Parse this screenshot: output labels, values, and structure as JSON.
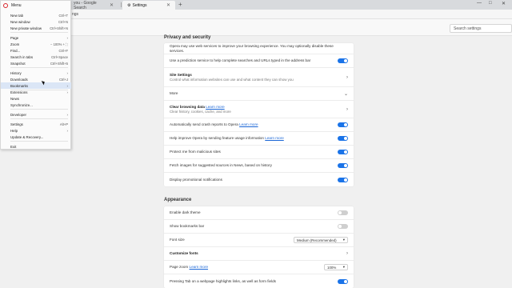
{
  "tabs": [
    {
      "label": "you - Google Search"
    },
    {
      "label": "Settings",
      "active": true
    }
  ],
  "window_controls": {
    "minimize": "—",
    "maximize": "□",
    "close": "✕"
  },
  "address": {
    "text": "ngs"
  },
  "settings": {
    "search_placeholder": "Search settings"
  },
  "menu": {
    "title": "Menu",
    "items": [
      {
        "label": "New tab",
        "shortcut": "Ctrl+T"
      },
      {
        "label": "New window",
        "shortcut": "Ctrl+N"
      },
      {
        "label": "New private window",
        "shortcut": "Ctrl+Shift+N"
      },
      {
        "label": "Page",
        "arrow": "›"
      },
      {
        "label": "Zoom",
        "shortcut": "− 100% +  ⛶"
      },
      {
        "label": "Find...",
        "shortcut": "Ctrl+F"
      },
      {
        "label": "Search in tabs",
        "shortcut": "Ctrl+Space"
      },
      {
        "label": "Snapshot",
        "shortcut": "Ctrl+Shift+5"
      },
      {
        "label": "History",
        "arrow": "›"
      },
      {
        "label": "Downloads",
        "shortcut": "Ctrl+J"
      },
      {
        "label": "Bookmarks",
        "arrow": "›"
      },
      {
        "label": "Extensions",
        "arrow": "›"
      },
      {
        "label": "News"
      },
      {
        "label": "Synchronize..."
      },
      {
        "label": "Developer",
        "arrow": "›"
      },
      {
        "label": "Settings",
        "shortcut": "Alt+P"
      },
      {
        "label": "Help",
        "arrow": "›"
      },
      {
        "label": "Update & Recovery..."
      },
      {
        "label": "Exit"
      }
    ]
  },
  "privacy": {
    "title": "Privacy and security",
    "intro": "Opera may use web services to improve your browsing experience. You may optionally disable these services.",
    "rows": [
      {
        "label": "Use a prediction service to help complete searches and URLs typed in the address bar",
        "state": "on"
      },
      {
        "label": "Site Settings",
        "sub": "Control what information websites can use and what content they can show you"
      },
      {
        "label": "More"
      },
      {
        "label": "Clear browsing data",
        "link": "Learn more",
        "sub": "Clear history, cookies, cache, and more"
      },
      {
        "label": "Automatically send crash reports to Opera",
        "link": "Learn more",
        "state": "on"
      },
      {
        "label": "Help improve Opera by sending feature usage information",
        "link": "Learn more",
        "state": "on"
      },
      {
        "label": "Protect me from malicious sites",
        "state": "on"
      },
      {
        "label": "Fetch images for suggested sources in News, based on history",
        "state": "on"
      },
      {
        "label": "Display promotional notifications",
        "state": "on"
      }
    ]
  },
  "appearance": {
    "title": "Appearance",
    "rows": [
      {
        "label": "Enable dark theme",
        "state": "off"
      },
      {
        "label": "Show bookmarks bar",
        "state": "off"
      },
      {
        "label": "Font size",
        "select": "Medium (Recommended)"
      },
      {
        "label": "Customize fonts"
      },
      {
        "label": "Page zoom",
        "link": "Learn more",
        "select": "100%"
      },
      {
        "label": "Pressing Tab on a webpage highlights links, as well as form fields",
        "state": "on"
      }
    ]
  },
  "icons": {
    "chevron": "›",
    "expand": "⌄",
    "dropdown": "▾",
    "new_tab": "+",
    "sidebar": "…"
  },
  "colors": {
    "accent": "#1a73e8",
    "opera_red": "#d8232a"
  }
}
